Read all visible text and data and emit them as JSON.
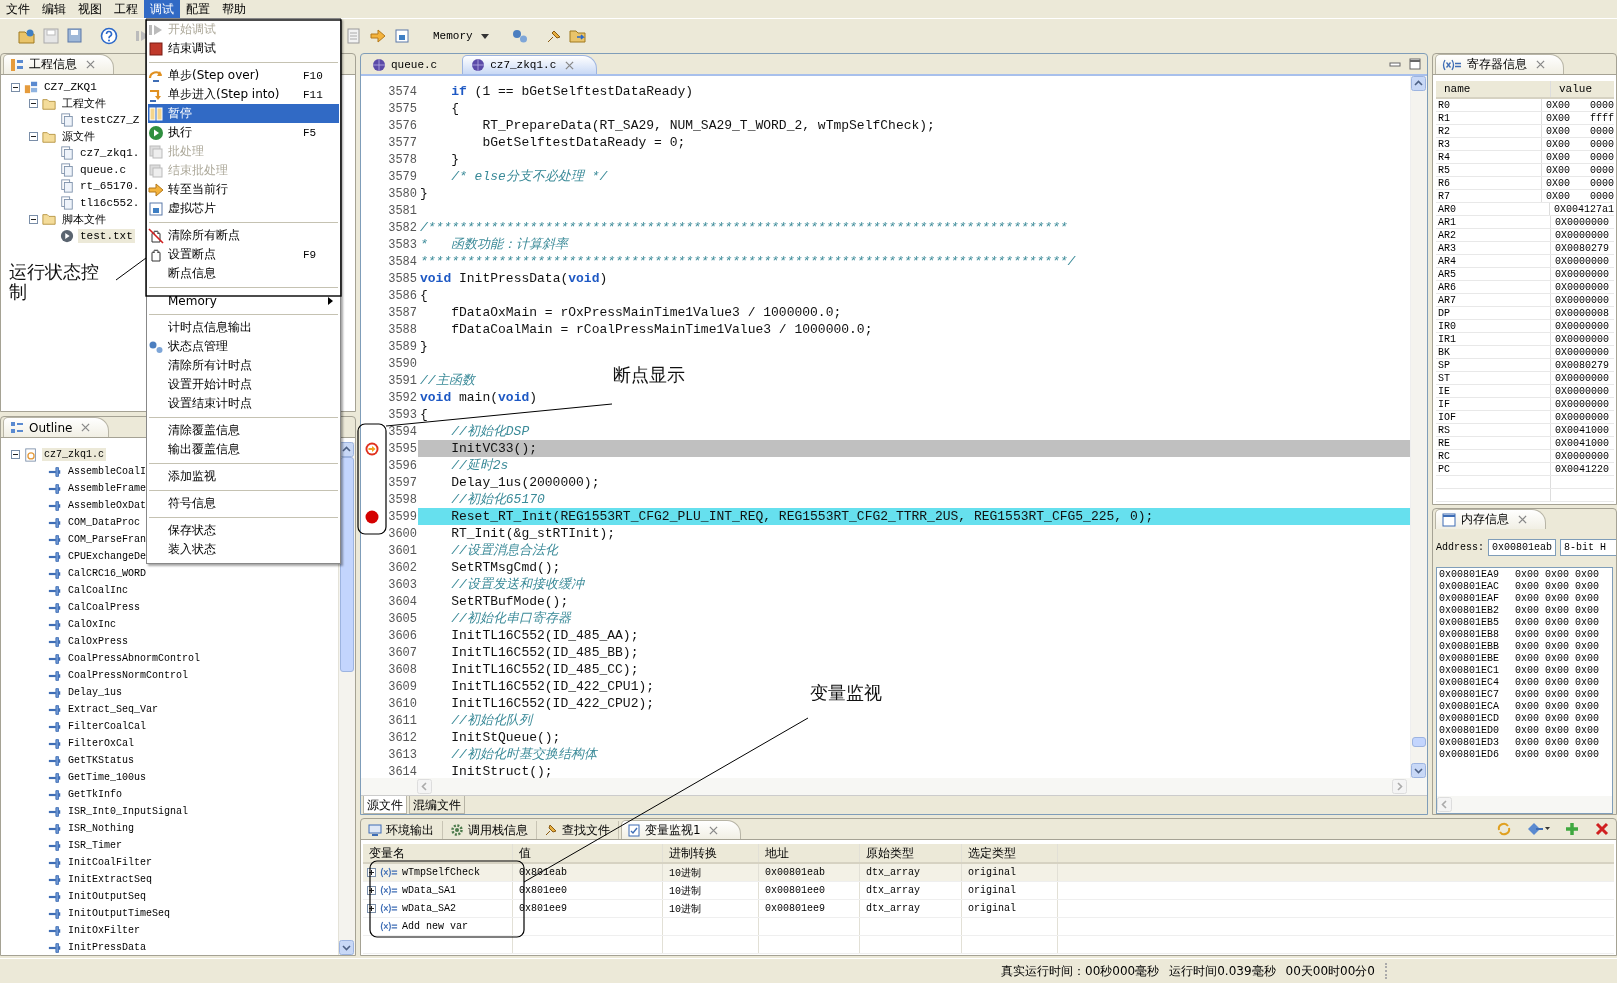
{
  "menubar": [
    {
      "label": "文件",
      "selected": false
    },
    {
      "label": "编辑",
      "selected": false
    },
    {
      "label": "视图",
      "selected": false
    },
    {
      "label": "工程",
      "selected": false
    },
    {
      "label": "调试",
      "selected": true
    },
    {
      "label": "配置",
      "selected": false
    },
    {
      "label": "帮助",
      "selected": false
    }
  ],
  "toolbar": {
    "memory_dropdown": "Memory"
  },
  "project_panel": {
    "title": "工程信息",
    "tree": [
      {
        "kind": "project",
        "label": "CZ7_ZKQ1",
        "expanded": true,
        "selected": false,
        "children": [
          {
            "kind": "folder",
            "label": "工程文件",
            "expanded": true,
            "selected": false,
            "children": [
              {
                "kind": "file",
                "label": "testCZ7_Z",
                "selected": false
              }
            ]
          },
          {
            "kind": "folder",
            "label": "源文件",
            "expanded": true,
            "selected": false,
            "children": [
              {
                "kind": "file",
                "label": "cz7_zkq1.",
                "selected": false
              },
              {
                "kind": "file",
                "label": "queue.c",
                "selected": false
              },
              {
                "kind": "file",
                "label": "rt_65170.",
                "selected": false
              },
              {
                "kind": "file",
                "label": "tl16c552.",
                "selected": false
              }
            ]
          },
          {
            "kind": "folder",
            "label": "脚本文件",
            "expanded": true,
            "selected": false,
            "children": [
              {
                "kind": "script",
                "label": "test.txt",
                "selected": true
              }
            ]
          }
        ]
      }
    ]
  },
  "debug_menu": [
    {
      "kind": "item",
      "label": "开始调试",
      "disabled": true,
      "selected": false
    },
    {
      "kind": "item",
      "label": "结束调试",
      "disabled": false,
      "selected": false
    },
    {
      "kind": "separator"
    },
    {
      "kind": "item",
      "label": "单步(Step over)",
      "shortcut": "F10",
      "disabled": false,
      "selected": false
    },
    {
      "kind": "item",
      "label": "单步进入(Step into)",
      "shortcut": "F11",
      "disabled": false,
      "selected": false
    },
    {
      "kind": "item",
      "label": "暂停",
      "disabled": false,
      "selected": true
    },
    {
      "kind": "item",
      "label": "执行",
      "shortcut": "F5",
      "disabled": false,
      "selected": false
    },
    {
      "kind": "item",
      "label": "批处理",
      "disabled": true,
      "selected": false
    },
    {
      "kind": "item",
      "label": "结束批处理",
      "disabled": true,
      "selected": false
    },
    {
      "kind": "item",
      "label": "转至当前行",
      "disabled": false,
      "selected": false
    },
    {
      "kind": "item",
      "label": "虚拟芯片",
      "disabled": false,
      "selected": false
    },
    {
      "kind": "separator"
    },
    {
      "kind": "item",
      "label": "清除所有断点",
      "disabled": false,
      "selected": false
    },
    {
      "kind": "item",
      "label": "设置断点",
      "shortcut": "F9",
      "disabled": false,
      "selected": false
    },
    {
      "kind": "item",
      "label": "断点信息",
      "disabled": false,
      "selected": false
    },
    {
      "kind": "separator"
    },
    {
      "kind": "submenu",
      "label": "Memory",
      "disabled": false,
      "selected": false
    },
    {
      "kind": "separator"
    },
    {
      "kind": "item",
      "label": "计时点信息输出",
      "disabled": false,
      "selected": false
    },
    {
      "kind": "item",
      "label": "状态点管理",
      "disabled": false,
      "selected": false
    },
    {
      "kind": "item",
      "label": "清除所有计时点",
      "disabled": false,
      "selected": false
    },
    {
      "kind": "item",
      "label": "设置开始计时点",
      "disabled": false,
      "selected": false
    },
    {
      "kind": "item",
      "label": "设置结束计时点",
      "disabled": false,
      "selected": false
    },
    {
      "kind": "separator"
    },
    {
      "kind": "item",
      "label": "清除覆盖信息",
      "disabled": false,
      "selected": false
    },
    {
      "kind": "item",
      "label": "输出覆盖信息",
      "disabled": false,
      "selected": false
    },
    {
      "kind": "separator"
    },
    {
      "kind": "item",
      "label": "添加监视",
      "disabled": false,
      "selected": false
    },
    {
      "kind": "separator"
    },
    {
      "kind": "item",
      "label": "符号信息",
      "disabled": false,
      "selected": false
    },
    {
      "kind": "separator"
    },
    {
      "kind": "item",
      "label": "保存状态",
      "disabled": false,
      "selected": false
    },
    {
      "kind": "item",
      "label": "装入状态",
      "disabled": false,
      "selected": false
    }
  ],
  "outline_panel": {
    "title": "Outline",
    "tree": [
      {
        "kind": "source",
        "label": "cz7_zkq1.c",
        "expanded": true,
        "selected": true,
        "children": [
          {
            "kind": "function",
            "label": "AssembleCoalI",
            "selected": false
          },
          {
            "kind": "function",
            "label": "AssembleFrame",
            "selected": false
          },
          {
            "kind": "function",
            "label": "AssembleOxDat",
            "selected": false
          },
          {
            "kind": "function",
            "label": "COM_DataProc",
            "selected": false
          },
          {
            "kind": "function",
            "label": "COM_ParseFran",
            "selected": false
          },
          {
            "kind": "function",
            "label": "CPUExchangeDe",
            "selected": false
          },
          {
            "kind": "function",
            "label": "CalCRC16_WORD",
            "selected": false
          },
          {
            "kind": "function",
            "label": "CalCoalInc",
            "selected": false
          },
          {
            "kind": "function",
            "label": "CalCoalPress",
            "selected": false
          },
          {
            "kind": "function",
            "label": "CalOxInc",
            "selected": false
          },
          {
            "kind": "function",
            "label": "CalOxPress",
            "selected": false
          },
          {
            "kind": "function",
            "label": "CoalPressAbnormControl",
            "selected": false
          },
          {
            "kind": "function",
            "label": "CoalPressNormControl",
            "selected": false
          },
          {
            "kind": "function",
            "label": "Delay_1us",
            "selected": false
          },
          {
            "kind": "function",
            "label": "Extract_Seq_Var",
            "selected": false
          },
          {
            "kind": "function",
            "label": "FilterCoalCal",
            "selected": false
          },
          {
            "kind": "function",
            "label": "FilterOxCal",
            "selected": false
          },
          {
            "kind": "function",
            "label": "GetTKStatus",
            "selected": false
          },
          {
            "kind": "function",
            "label": "GetTime_100us",
            "selected": false
          },
          {
            "kind": "function",
            "label": "GetTkInfo",
            "selected": false
          },
          {
            "kind": "function",
            "label": "ISR_Int0_InputSignal",
            "selected": false
          },
          {
            "kind": "function",
            "label": "ISR_Nothing",
            "selected": false
          },
          {
            "kind": "function",
            "label": "ISR_Timer",
            "selected": false
          },
          {
            "kind": "function",
            "label": "InitCoalFilter",
            "selected": false
          },
          {
            "kind": "function",
            "label": "InitExtractSeq",
            "selected": false
          },
          {
            "kind": "function",
            "label": "InitOutputSeq",
            "selected": false
          },
          {
            "kind": "function",
            "label": "InitOutputTimeSeq",
            "selected": false
          },
          {
            "kind": "function",
            "label": "InitOxFilter",
            "selected": false
          },
          {
            "kind": "function",
            "label": "InitPressData",
            "selected": false
          }
        ]
      }
    ]
  },
  "editor": {
    "tabs": [
      {
        "label": "queue.c",
        "selected": false
      },
      {
        "label": "cz7_zkq1.c",
        "selected": true
      }
    ],
    "lines": [
      {
        "kind": "plain",
        "num": "3574",
        "parts": [
          {
            "kind": "keyword",
            "text": "    if"
          },
          {
            "kind": "code",
            "text": " (1 == bGetSelftestDataReady)"
          }
        ]
      },
      {
        "kind": "plain",
        "num": "3575",
        "parts": [
          {
            "kind": "code",
            "text": "    {"
          }
        ]
      },
      {
        "kind": "plain",
        "num": "3576",
        "parts": [
          {
            "kind": "code",
            "text": "        RT_PrepareData(RT_SA29, NUM_SA29_T_WORD_2, wTmpSelfCheck);"
          }
        ]
      },
      {
        "kind": "plain",
        "num": "3577",
        "parts": [
          {
            "kind": "code",
            "text": "        bGetSelftestDataReady = 0;"
          }
        ]
      },
      {
        "kind": "plain",
        "num": "3578",
        "parts": [
          {
            "kind": "code",
            "text": "    }"
          }
        ]
      },
      {
        "kind": "plain",
        "num": "3579",
        "parts": [
          {
            "kind": "comment",
            "text": "    /* else分支不必处理 */"
          }
        ]
      },
      {
        "kind": "plain",
        "num": "3580",
        "parts": [
          {
            "kind": "code",
            "text": "}"
          }
        ]
      },
      {
        "kind": "plain",
        "num": "3581"
      },
      {
        "kind": "plain",
        "num": "3582",
        "parts": [
          {
            "kind": "comment",
            "text": "/**********************************************************************************"
          }
        ]
      },
      {
        "kind": "plain",
        "num": "3583",
        "parts": [
          {
            "kind": "comment",
            "text": "*   函数功能：计算斜率"
          }
        ]
      },
      {
        "kind": "plain",
        "num": "3584",
        "parts": [
          {
            "kind": "comment",
            "text": "***********************************************************************************/"
          }
        ]
      },
      {
        "kind": "plain",
        "num": "3585",
        "parts": [
          {
            "kind": "keyword",
            "text": "void"
          },
          {
            "kind": "code",
            "text": " InitPressData("
          },
          {
            "kind": "keyword",
            "text": "void"
          },
          {
            "kind": "code",
            "text": ")"
          }
        ]
      },
      {
        "kind": "plain",
        "num": "3586",
        "parts": [
          {
            "kind": "code",
            "text": "{"
          }
        ]
      },
      {
        "kind": "plain",
        "num": "3587",
        "parts": [
          {
            "kind": "code",
            "text": "    fDataOxMain = rOxPressMainTime1Value3 / 1000000.0;"
          }
        ]
      },
      {
        "kind": "plain",
        "num": "3588",
        "parts": [
          {
            "kind": "code",
            "text": "    fDataCoalMain = rCoalPressMainTime1Value3 / 1000000.0;"
          }
        ]
      },
      {
        "kind": "plain",
        "num": "3589",
        "parts": [
          {
            "kind": "code",
            "text": "}"
          }
        ]
      },
      {
        "kind": "plain",
        "num": "3590"
      },
      {
        "kind": "plain",
        "num": "3591",
        "parts": [
          {
            "kind": "comment",
            "text": "//主函数"
          }
        ]
      },
      {
        "kind": "plain",
        "num": "3592",
        "parts": [
          {
            "kind": "keyword",
            "text": "void"
          },
          {
            "kind": "code",
            "text": " main("
          },
          {
            "kind": "keyword",
            "text": "void"
          },
          {
            "kind": "code",
            "text": ")"
          }
        ]
      },
      {
        "kind": "plain",
        "num": "3593",
        "parts": [
          {
            "kind": "code",
            "text": "{"
          }
        ]
      },
      {
        "kind": "plain",
        "num": "3594",
        "parts": [
          {
            "kind": "comment",
            "text": "    //初始化DSP"
          }
        ]
      },
      {
        "kind": "current",
        "num": "3595",
        "parts": [
          {
            "kind": "code",
            "text": "    InitVC33();"
          }
        ]
      },
      {
        "kind": "plain",
        "num": "3596",
        "parts": [
          {
            "kind": "comment",
            "text": "    //延时2s"
          }
        ]
      },
      {
        "kind": "plain",
        "num": "3597",
        "parts": [
          {
            "kind": "code",
            "text": "    Delay_1us(2000000);"
          }
        ]
      },
      {
        "kind": "plain",
        "num": "3598",
        "parts": [
          {
            "kind": "comment",
            "text": "    //初始化65170"
          }
        ]
      },
      {
        "kind": "breakpoint",
        "num": "3599",
        "parts": [
          {
            "kind": "code",
            "text": "    Reset_RT_Init(REG1553RT_CFG2_PLU_INT_REQ, REG1553RT_CFG2_TTRR_2US, REG1553RT_CFG5_225, 0);"
          }
        ]
      },
      {
        "kind": "plain",
        "num": "3600",
        "parts": [
          {
            "kind": "code",
            "text": "    RT_Init(&g_stRTInit);"
          }
        ]
      },
      {
        "kind": "plain",
        "num": "3601",
        "parts": [
          {
            "kind": "comment",
            "text": "    //设置消息合法化"
          }
        ]
      },
      {
        "kind": "plain",
        "num": "3602",
        "parts": [
          {
            "kind": "code",
            "text": "    SetRTMsgCmd();"
          }
        ]
      },
      {
        "kind": "plain",
        "num": "3603",
        "parts": [
          {
            "kind": "comment",
            "text": "    //设置发送和接收缓冲"
          }
        ]
      },
      {
        "kind": "plain",
        "num": "3604",
        "parts": [
          {
            "kind": "code",
            "text": "    SetRTBufMode();"
          }
        ]
      },
      {
        "kind": "plain",
        "num": "3605",
        "parts": [
          {
            "kind": "comment",
            "text": "    //初始化串口寄存器"
          }
        ]
      },
      {
        "kind": "plain",
        "num": "3606",
        "parts": [
          {
            "kind": "code",
            "text": "    InitTL16C552(ID_485_AA);"
          }
        ]
      },
      {
        "kind": "plain",
        "num": "3607",
        "parts": [
          {
            "kind": "code",
            "text": "    InitTL16C552(ID_485_BB);"
          }
        ]
      },
      {
        "kind": "plain",
        "num": "3608",
        "parts": [
          {
            "kind": "code",
            "text": "    InitTL16C552(ID_485_CC);"
          }
        ]
      },
      {
        "kind": "plain",
        "num": "3609",
        "parts": [
          {
            "kind": "code",
            "text": "    InitTL16C552(ID_422_CPU1);"
          }
        ]
      },
      {
        "kind": "plain",
        "num": "3610",
        "parts": [
          {
            "kind": "code",
            "text": "    InitTL16C552(ID_422_CPU2);"
          }
        ]
      },
      {
        "kind": "plain",
        "num": "3611",
        "parts": [
          {
            "kind": "comment",
            "text": "    //初始化队列"
          }
        ]
      },
      {
        "kind": "plain",
        "num": "3612",
        "parts": [
          {
            "kind": "code",
            "text": "    InitStQueue();"
          }
        ]
      },
      {
        "kind": "plain",
        "num": "3613",
        "parts": [
          {
            "kind": "comment",
            "text": "    //初始化时基交换结构体"
          }
        ]
      },
      {
        "kind": "plain",
        "num": "3614",
        "parts": [
          {
            "kind": "code",
            "text": "    InitStruct();"
          }
        ]
      }
    ],
    "bottom_tabs": [
      {
        "label": "源文件",
        "selected": true
      },
      {
        "label": "混编文件",
        "selected": false
      }
    ]
  },
  "registers": {
    "title": "寄存器信息",
    "columns": [
      "name",
      "value"
    ],
    "rows": [
      {
        "name": "R0",
        "value": "0X00 0000"
      },
      {
        "name": "R1",
        "value": "0X00 ffff"
      },
      {
        "name": "R2",
        "value": "0X00 0000"
      },
      {
        "name": "R3",
        "value": "0X00 0000"
      },
      {
        "name": "R4",
        "value": "0X00 0000"
      },
      {
        "name": "R5",
        "value": "0X00 0000"
      },
      {
        "name": "R6",
        "value": "0X00 0000"
      },
      {
        "name": "R7",
        "value": "0X00 0000"
      },
      {
        "name": "AR0",
        "value": "0X004127a1"
      },
      {
        "name": "AR1",
        "value": "0X0000000"
      },
      {
        "name": "AR2",
        "value": "0X0000000"
      },
      {
        "name": "AR3",
        "value": "0X0080279"
      },
      {
        "name": "AR4",
        "value": "0X0000000"
      },
      {
        "name": "AR5",
        "value": "0X0000000"
      },
      {
        "name": "AR6",
        "value": "0X0000000"
      },
      {
        "name": "AR7",
        "value": "0X0000000"
      },
      {
        "name": "DP",
        "value": "0X0000008"
      },
      {
        "name": "IR0",
        "value": "0X0000000"
      },
      {
        "name": "IR1",
        "value": "0X0000000"
      },
      {
        "name": "BK",
        "value": "0X0000000"
      },
      {
        "name": "SP",
        "value": "0X0080279"
      },
      {
        "name": "ST",
        "value": "0X0000000"
      },
      {
        "name": "IE",
        "value": "0X0000000"
      },
      {
        "name": "IF",
        "value": "0X0000000"
      },
      {
        "name": "IOF",
        "value": "0X0000000"
      },
      {
        "name": "RS",
        "value": "0X0041000"
      },
      {
        "name": "RE",
        "value": "0X0041000"
      },
      {
        "name": "RC",
        "value": "0X0000000"
      },
      {
        "name": "PC",
        "value": "0X0041220"
      }
    ]
  },
  "memory": {
    "title": "内存信息",
    "address_label": "Address:",
    "address": "0x00801eab",
    "format": "8-bit H",
    "rows": [
      {
        "address": "0x00801EA9",
        "bytes": [
          "0x00",
          "0x00",
          "0x00"
        ]
      },
      {
        "address": "0x00801EAC",
        "bytes": [
          "0x00",
          "0x00",
          "0x00"
        ]
      },
      {
        "address": "0x00801EAF",
        "bytes": [
          "0x00",
          "0x00",
          "0x00"
        ]
      },
      {
        "address": "0x00801EB2",
        "bytes": [
          "0x00",
          "0x00",
          "0x00"
        ]
      },
      {
        "address": "0x00801EB5",
        "bytes": [
          "0x00",
          "0x00",
          "0x00"
        ]
      },
      {
        "address": "0x00801EB8",
        "bytes": [
          "0x00",
          "0x00",
          "0x00"
        ]
      },
      {
        "address": "0x00801EBB",
        "bytes": [
          "0x00",
          "0x00",
          "0x00"
        ]
      },
      {
        "address": "0x00801EBE",
        "bytes": [
          "0x00",
          "0x00",
          "0x00"
        ]
      },
      {
        "address": "0x00801EC1",
        "bytes": [
          "0x00",
          "0x00",
          "0x00"
        ]
      },
      {
        "address": "0x00801EC4",
        "bytes": [
          "0x00",
          "0x00",
          "0x00"
        ]
      },
      {
        "address": "0x00801EC7",
        "bytes": [
          "0x00",
          "0x00",
          "0x00"
        ]
      },
      {
        "address": "0x00801ECA",
        "bytes": [
          "0x00",
          "0x00",
          "0x00"
        ]
      },
      {
        "address": "0x00801ECD",
        "bytes": [
          "0x00",
          "0x00",
          "0x00"
        ]
      },
      {
        "address": "0x00801ED0",
        "bytes": [
          "0x00",
          "0x00",
          "0x00"
        ]
      },
      {
        "address": "0x00801ED3",
        "bytes": [
          "0x00",
          "0x00",
          "0x00"
        ]
      },
      {
        "address": "0x00801ED6",
        "bytes": [
          "0x00",
          "0x00",
          "0x00"
        ]
      }
    ]
  },
  "watch": {
    "tabs": [
      {
        "label": "环境输出",
        "selected": false
      },
      {
        "label": "调用栈信息",
        "selected": false
      },
      {
        "label": "查找文件",
        "selected": false
      },
      {
        "label": "变量监视1",
        "selected": true
      }
    ],
    "columns": [
      "变量名",
      "值",
      "进制转换",
      "地址",
      "原始类型",
      "选定类型"
    ],
    "rows": [
      {
        "kind": "variable",
        "expanded": false,
        "selected": true,
        "name": "wTmpSelfCheck",
        "value": "0x801eab",
        "radix": "10进制",
        "address": "0x00801eab",
        "raw_type": "dtx_array",
        "chosen_type": "original"
      },
      {
        "kind": "variable",
        "expanded": false,
        "selected": false,
        "name": "wData_SA1",
        "value": "0x801ee0",
        "radix": "10进制",
        "address": "0x00801ee0",
        "raw_type": "dtx_array",
        "chosen_type": "original"
      },
      {
        "kind": "variable",
        "expanded": false,
        "selected": false,
        "name": "wData_SA2",
        "value": "0x801ee9",
        "radix": "10进制",
        "address": "0x00801ee9",
        "raw_type": "dtx_array",
        "chosen_type": "original"
      },
      {
        "kind": "add",
        "name": "Add new var"
      }
    ]
  },
  "status_bar": [
    "真实运行时间：00秒000毫秒",
    "运行时间0.039毫秒",
    "00天00时00分0"
  ],
  "annotations": [
    "运行状态控制",
    "断点显示",
    "变量监视"
  ]
}
